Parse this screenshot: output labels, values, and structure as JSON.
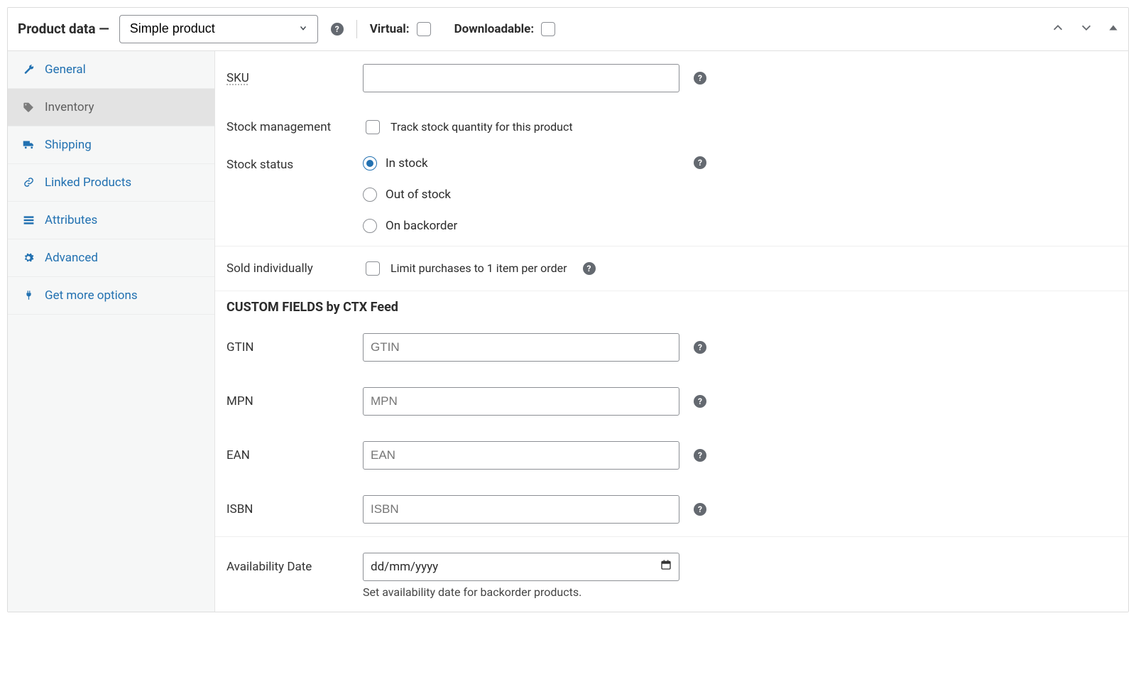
{
  "header": {
    "title": "Product data —",
    "product_type": "Simple product",
    "help_icon": "?",
    "virtual_label": "Virtual:",
    "downloadable_label": "Downloadable:"
  },
  "sidebar": {
    "items": [
      {
        "label": "General",
        "icon": "wrench"
      },
      {
        "label": "Inventory",
        "icon": "tag",
        "active": true
      },
      {
        "label": "Shipping",
        "icon": "truck"
      },
      {
        "label": "Linked Products",
        "icon": "link"
      },
      {
        "label": "Attributes",
        "icon": "list"
      },
      {
        "label": "Advanced",
        "icon": "gear"
      },
      {
        "label": "Get more options",
        "icon": "plug"
      }
    ]
  },
  "inventory": {
    "sku_label": "SKU",
    "sku_value": "",
    "stock_mgmt_label": "Stock management",
    "stock_mgmt_option": "Track stock quantity for this product",
    "stock_status_label": "Stock status",
    "stock_status_options": [
      "In stock",
      "Out of stock",
      "On backorder"
    ],
    "stock_status_selected": 0,
    "sold_indiv_label": "Sold individually",
    "sold_indiv_option": "Limit purchases to 1 item per order",
    "help_icon": "?",
    "custom_heading": "CUSTOM FIELDS by CTX Feed",
    "custom_fields": [
      {
        "label": "GTIN",
        "placeholder": "GTIN"
      },
      {
        "label": "MPN",
        "placeholder": "MPN"
      },
      {
        "label": "EAN",
        "placeholder": "EAN"
      },
      {
        "label": "ISBN",
        "placeholder": "ISBN"
      }
    ],
    "availability_label": "Availability Date",
    "availability_placeholder": "dd/mm/yyyy",
    "availability_hint": "Set availability date for backorder products."
  }
}
